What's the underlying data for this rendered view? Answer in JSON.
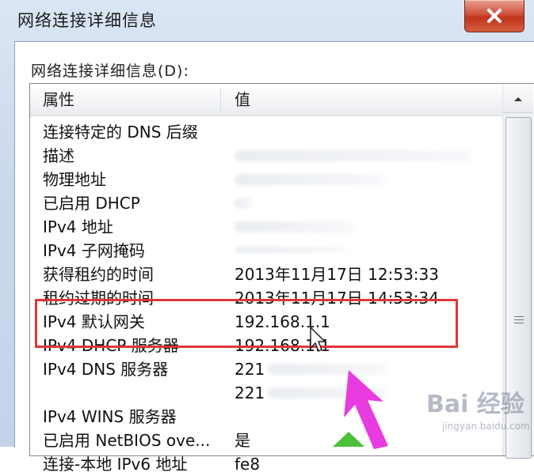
{
  "window": {
    "title": "网络连接详细信息"
  },
  "details_label": "网络连接详细信息(D):",
  "table": {
    "headers": {
      "property": "属性",
      "value": "值"
    },
    "rows": [
      {
        "property": "连接特定的 DNS 后缀",
        "value": ""
      },
      {
        "property": "描述",
        "value": ""
      },
      {
        "property": "物理地址",
        "value": ""
      },
      {
        "property": "已启用 DHCP",
        "value": ""
      },
      {
        "property": "IPv4 地址",
        "value": ""
      },
      {
        "property": "IPv4 子网掩码",
        "value": ""
      },
      {
        "property": "获得租约的时间",
        "value": "2013年11月17日 12:53:33"
      },
      {
        "property": "租约过期的时间",
        "value": "2013年11月17日 14:53:34"
      },
      {
        "property": "IPv4 默认网关",
        "value": "192.168.1.1"
      },
      {
        "property": "IPv4 DHCP 服务器",
        "value": "192.168.1.1"
      },
      {
        "property": "IPv4 DNS 服务器",
        "value": "221"
      },
      {
        "property": "",
        "value": "221"
      },
      {
        "property": "IPv4 WINS 服务器",
        "value": ""
      },
      {
        "property": "已启用 NetBIOS ove...",
        "value": "是"
      },
      {
        "property": "连接-本地 IPv6 地址",
        "value": "fe8"
      }
    ]
  },
  "watermark": {
    "text": "Bai 经验",
    "sub": "jingyan.baidu.com"
  },
  "colors": {
    "highlight": "#e0363a",
    "arrow_pink": "#e83be0",
    "arrow_green": "#4cc03a",
    "close_button": "#c0341f"
  }
}
